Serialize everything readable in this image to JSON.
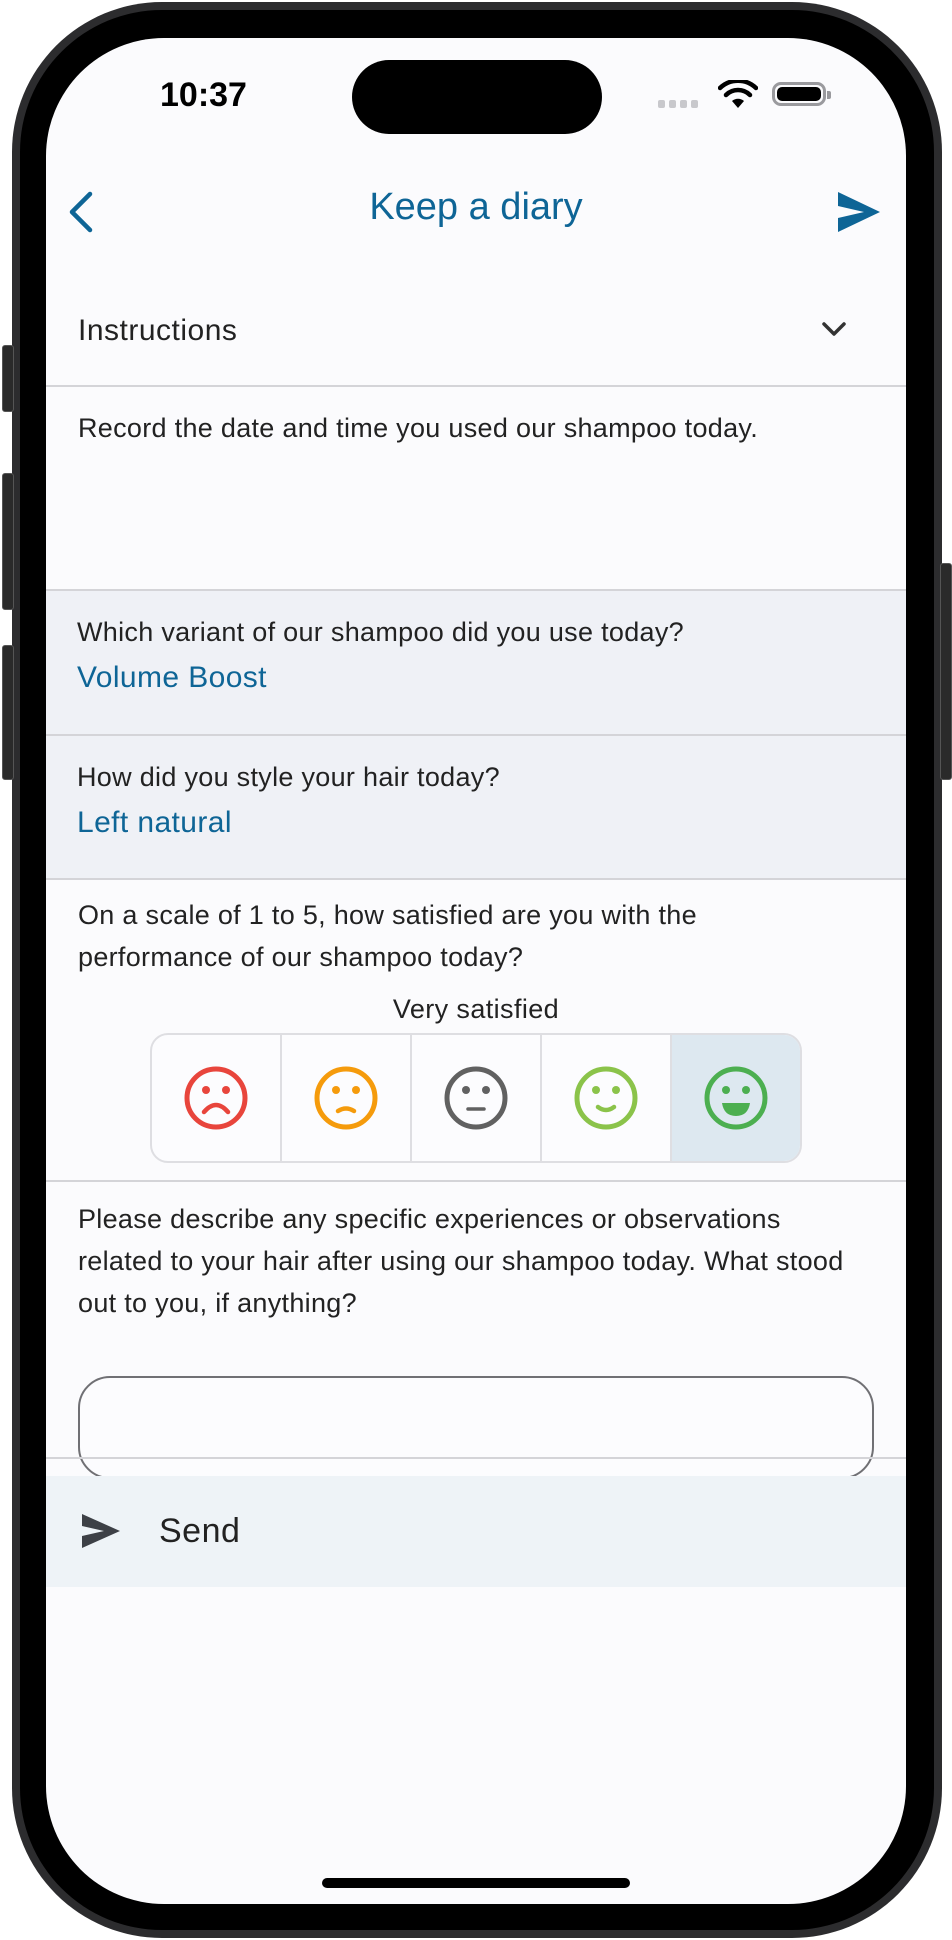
{
  "status_bar": {
    "time": "10:37",
    "signal_icon": "signal-dots-icon",
    "wifi_icon": "wifi-icon",
    "battery_icon": "battery-icon"
  },
  "nav": {
    "title": "Keep a diary",
    "back_icon": "chevron-left-icon",
    "send_icon": "send-icon"
  },
  "colors": {
    "accent": "#0e6596",
    "section_bg": "#eff1f6",
    "selected_bg": "#dde8f0",
    "send_band_bg": "#eef3f7"
  },
  "instructions": {
    "label": "Instructions",
    "toggle_icon": "chevron-down-icon",
    "body": "Record the date and time you used our shampoo today."
  },
  "questions": [
    {
      "question": "Which variant of our shampoo did you use today?",
      "answer": "Volume Boost"
    },
    {
      "question": "How did you style your hair today?",
      "answer": "Left natural"
    }
  ],
  "rating": {
    "question": "On a scale of 1 to 5, how satisfied are you with the performance of our shampoo today?",
    "selected_label": "Very satisfied",
    "selected_value": 5,
    "scale_max": 5,
    "options": [
      {
        "value": 1,
        "icon": "very-dissatisfied-face-icon",
        "color": "#e8453c"
      },
      {
        "value": 2,
        "icon": "dissatisfied-face-icon",
        "color": "#f59b0c"
      },
      {
        "value": 3,
        "icon": "neutral-face-icon",
        "color": "#616161"
      },
      {
        "value": 4,
        "icon": "satisfied-face-icon",
        "color": "#8bc34a"
      },
      {
        "value": 5,
        "icon": "very-satisfied-face-icon",
        "color": "#4caf50"
      }
    ]
  },
  "description": {
    "question": "Please describe any specific experiences or observations related to your hair after using our shampoo today. What stood out to you, if anything?",
    "value": "",
    "placeholder": ""
  },
  "send": {
    "label": "Send",
    "icon": "send-icon"
  }
}
